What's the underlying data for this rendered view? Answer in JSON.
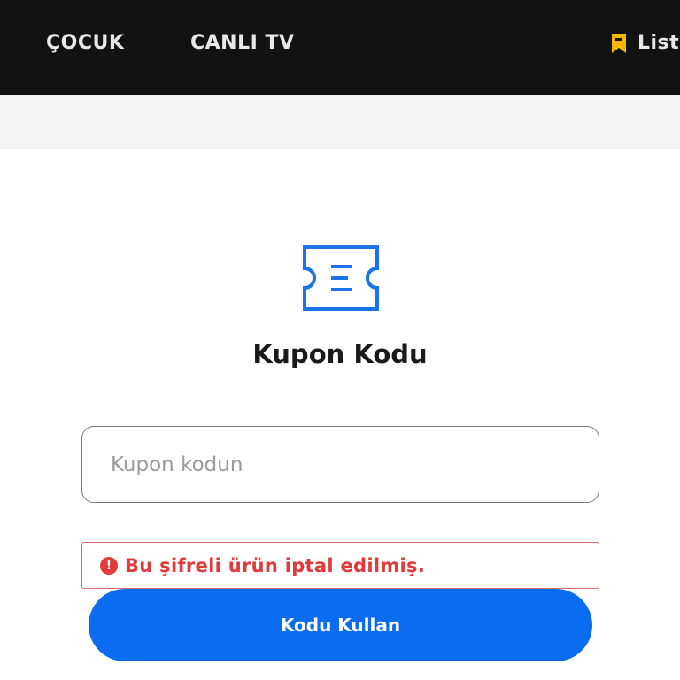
{
  "header": {
    "nav_items": [
      {
        "label": "ÇOCUK"
      },
      {
        "label": "CANLI TV"
      }
    ],
    "list_label": "List",
    "bookmark_icon": "bookmark-icon",
    "bookmark_color": "#f5b800"
  },
  "main": {
    "coupon_icon": "ticket-icon",
    "icon_color": "#1a73e8",
    "title": "Kupon Kodu",
    "input": {
      "placeholder": "Kupon kodun",
      "value": ""
    },
    "error": {
      "icon": "alert-circle-icon",
      "message": "Bu şifreli ürün iptal edilmiş."
    },
    "submit_label": "Kodu Kullan",
    "submit_color": "#0a6cf0"
  }
}
